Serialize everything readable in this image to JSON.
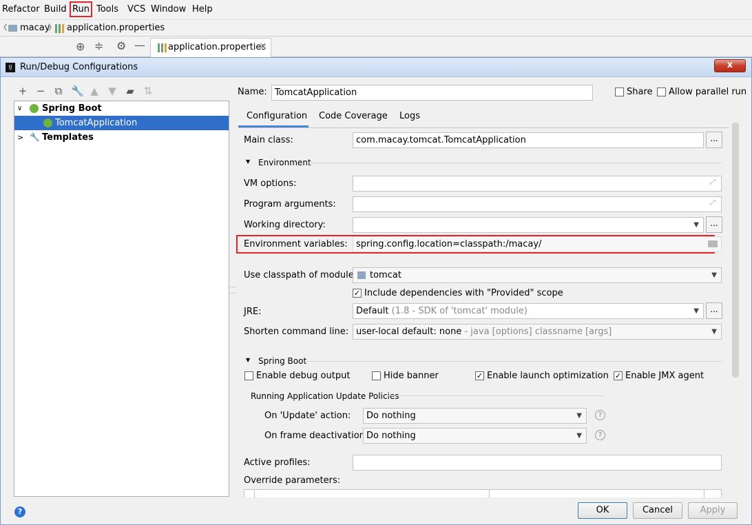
{
  "menubar": {
    "items": [
      "Refactor",
      "Build",
      "Run",
      "Tools",
      "VCS",
      "Window",
      "Help"
    ]
  },
  "navbar": {
    "project": "macay",
    "file": "application.properties"
  },
  "editor_tab": {
    "label": "application.properties",
    "close": "×"
  },
  "dialog": {
    "title": "Run/Debug Configurations",
    "close": "x",
    "tree": [
      {
        "label": "Spring Boot",
        "expand": "∨"
      },
      {
        "label": "TomcatApplication"
      },
      {
        "label": "Templates",
        "expand": ">"
      }
    ],
    "name_label": "Name:",
    "name_value": "TomcatApplication",
    "share_label": "Share",
    "allow_parallel_label": "Allow parallel run",
    "tabs": [
      "Configuration",
      "Code Coverage",
      "Logs"
    ],
    "main_class_label": "Main class:",
    "main_class_value": "com.macay.tomcat.TomcatApplication",
    "environment_section": "Environment",
    "vm_options_label": "VM options:",
    "program_arguments_label": "Program arguments:",
    "working_directory_label": "Working directory:",
    "env_vars_label": "Environment variables:",
    "env_vars_value": "spring.config.location=classpath:/macay/",
    "classpath_label": "Use classpath of module:",
    "classpath_value": "tomcat",
    "include_deps_label": "Include dependencies with \"Provided\" scope",
    "jre_label": "JRE:",
    "jre_value": "Default",
    "jre_hint": "(1.8 - SDK of 'tomcat' module)",
    "shorten_label": "Shorten command line:",
    "shorten_value": "user-local default: none",
    "shorten_hint": "- java [options] classname [args]",
    "spring_boot_section": "Spring Boot",
    "enable_debug_label": "Enable debug output",
    "hide_banner_label": "Hide banner",
    "enable_launch_label": "Enable launch optimization",
    "enable_jmx_label": "Enable JMX agent",
    "update_policies_section": "Running Application Update Policies",
    "on_update_label": "On 'Update' action:",
    "on_update_value": "Do nothing",
    "on_frame_label": "On frame deactivation:",
    "on_frame_value": "Do nothing",
    "active_profiles_label": "Active profiles:",
    "override_label": "Override parameters:",
    "help_glyph": "?",
    "ok": "OK",
    "cancel": "Cancel",
    "apply": "Apply"
  },
  "colors": {
    "selection": "#2f6fc9",
    "highlight_box": "#e0262b",
    "spring_green": "#6db33f"
  }
}
